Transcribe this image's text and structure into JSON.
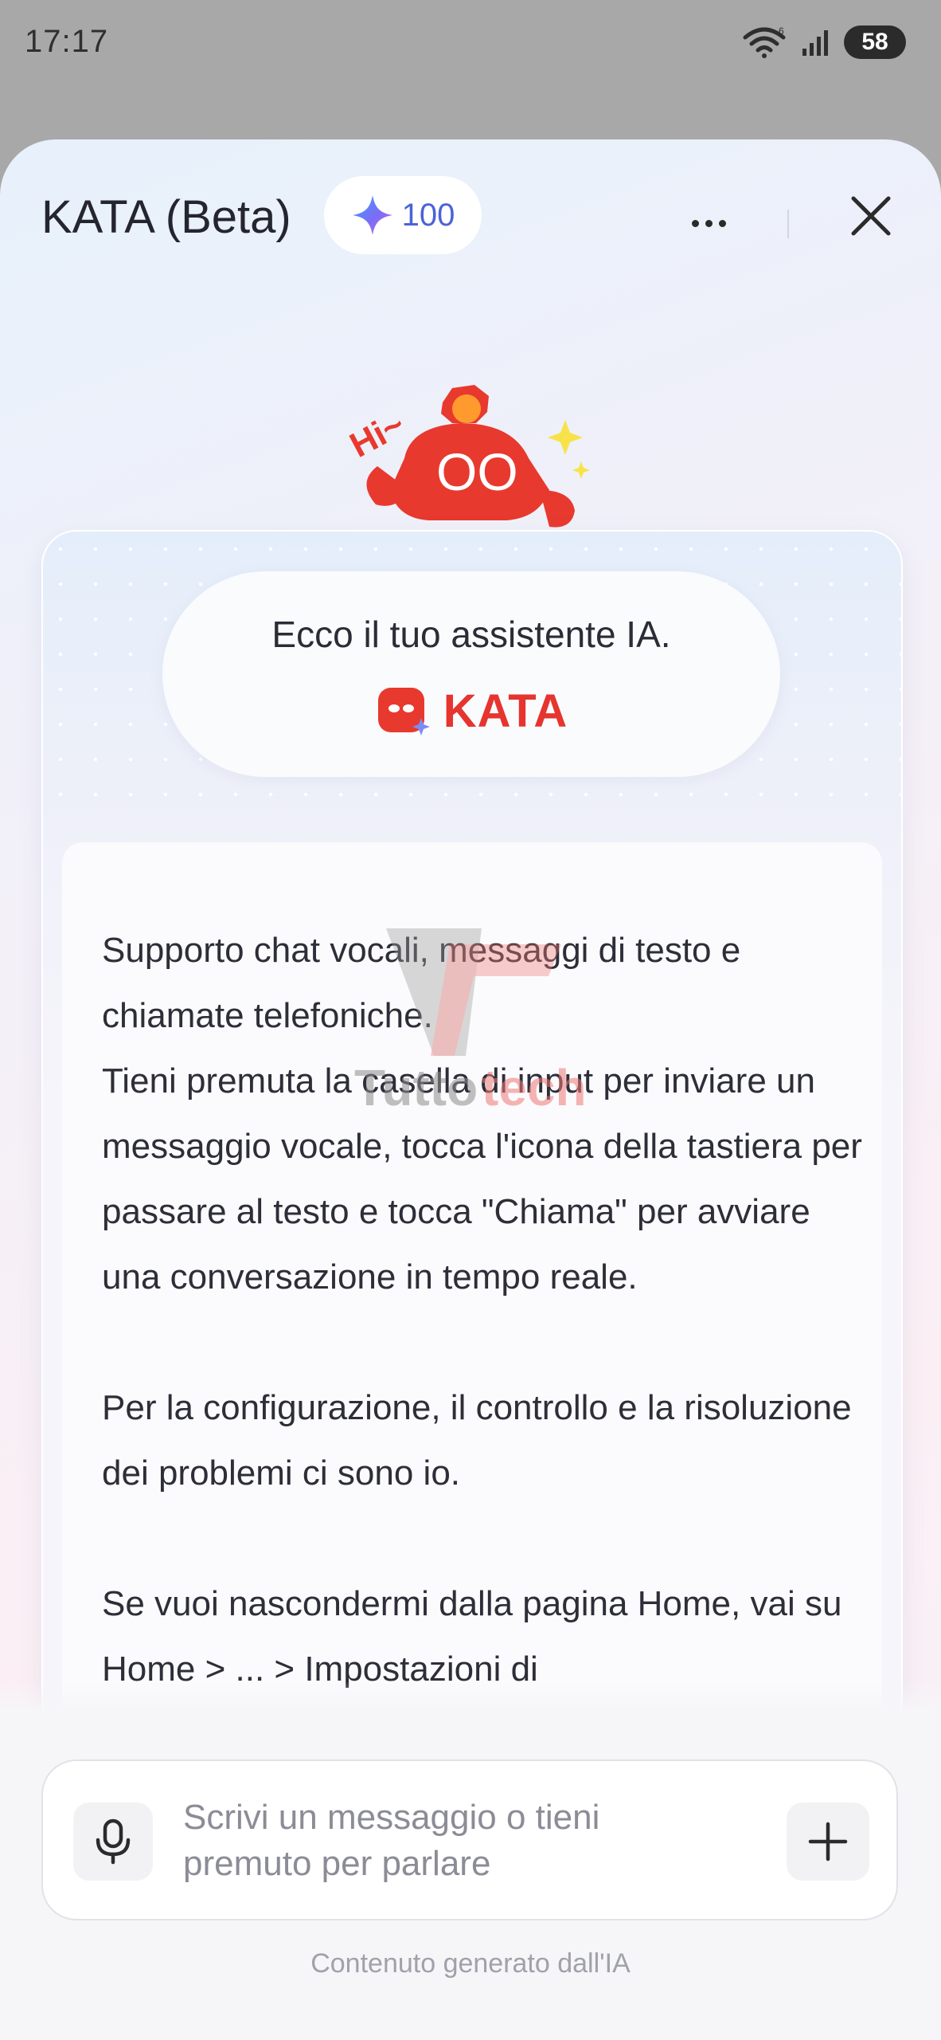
{
  "status_bar": {
    "time": "17:17",
    "network_badge": "6",
    "battery": "58"
  },
  "header": {
    "title": "KATA (Beta)",
    "credits": "100"
  },
  "mascot": {
    "greeting": "Hi~",
    "eyes": "OO"
  },
  "intro": {
    "text": "Ecco il tuo assistente IA.",
    "brand_name": "KATA"
  },
  "message": {
    "lines": [
      "Supporto chat vocali, messaggi di testo e chiamate telefoniche.",
      "Tieni premuta la casella di input per inviare un messaggio vocale, tocca l'icona della tastiera per passare al testo e tocca \"Chiama\" per avviare una conversazione in tempo reale.",
      "Per la configurazione, il controllo e la risoluzione dei problemi ci sono io.",
      "Se vuoi nascondermi dalla pagina Home, vai su Home > ... > Impostazioni di"
    ]
  },
  "watermark": {
    "text_dark": "Tutto",
    "text_red": "tech"
  },
  "composer": {
    "placeholder": "Scrivi un messaggio o tieni premuto per parlare"
  },
  "footer": {
    "disclaimer": "Contenuto generato dall'IA"
  },
  "colors": {
    "brand_red": "#e6342f",
    "credit_blue": "#4b63d6"
  }
}
